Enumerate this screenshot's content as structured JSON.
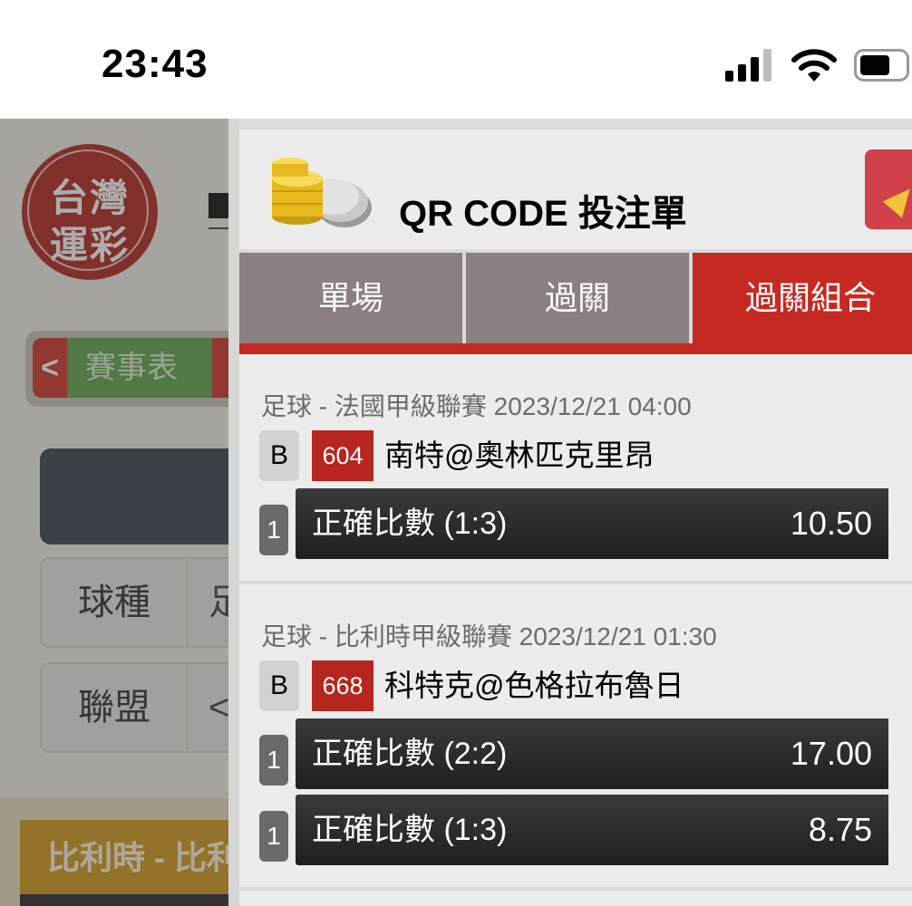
{
  "status_bar": {
    "time": "23:43"
  },
  "background_app": {
    "logo_line1": "台灣",
    "logo_line2": "運彩",
    "nav_back": "<",
    "nav_schedule": "賽事表",
    "filter_rows": [
      {
        "label": "球種",
        "value": "足"
      },
      {
        "label": "聯盟",
        "value": "<"
      }
    ],
    "league_header": "比利時 - 比利"
  },
  "bet_slip": {
    "title": "QR CODE 投注單",
    "tabs": [
      {
        "label": "單場",
        "active": false
      },
      {
        "label": "過關",
        "active": false
      },
      {
        "label": "過關組合",
        "active": true
      }
    ],
    "matches": [
      {
        "league": "足球 - 法國甲級聯賽 2023/12/21 04:00",
        "type": "B",
        "match_no": "604",
        "teams": "南特@奧林匹克里昂",
        "selections": [
          {
            "qty": "1",
            "name": "正確比數 (1:3)",
            "odds": "10.50"
          }
        ]
      },
      {
        "league": "足球 - 比利時甲級聯賽 2023/12/21 01:30",
        "type": "B",
        "match_no": "668",
        "teams": "科特克@色格拉布魯日",
        "selections": [
          {
            "qty": "1",
            "name": "正確比數 (2:2)",
            "odds": "17.00"
          },
          {
            "qty": "1",
            "name": "正確比數 (1:3)",
            "odds": "8.75"
          }
        ]
      }
    ]
  },
  "colors": {
    "accent_red": "#c42a21",
    "tab_inactive": "#8a7f82",
    "selection_dark": "#2b2b2b"
  }
}
